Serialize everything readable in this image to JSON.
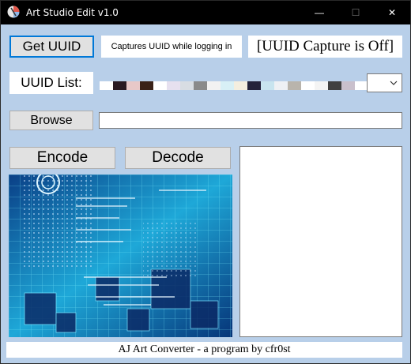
{
  "window": {
    "title": "Art Studio Edit v1.0",
    "controls": {
      "minimize": "—",
      "maximize": "☐",
      "close": "✕"
    }
  },
  "buttons": {
    "get_uuid": "Get UUID",
    "browse": "Browse",
    "encode": "Encode",
    "decode": "Decode"
  },
  "labels": {
    "capture_hint": "Captures UUID while logging in",
    "capture_status": "[UUID Capture is Off]",
    "uuid_list": "UUID List:"
  },
  "uuid_combo": {
    "swatches": [
      "#ffffff",
      "#2a1a22",
      "#e8c8c8",
      "#3a2218",
      "#ffffff",
      "#e6e0ef",
      "#d8dde3",
      "#8a8a8a",
      "#f2f2f2",
      "#d8f0f6",
      "#f4eedf",
      "#24223a",
      "#c8e4ef",
      "#eef0f4",
      "#b9b4ac",
      "#ffffff",
      "#f4f4f4",
      "#404040",
      "#c9c0cc",
      "#ffffff"
    ]
  },
  "browse_path": {
    "value": ""
  },
  "output_box": {
    "value": ""
  },
  "footer": {
    "text": "AJ Art Converter - a program by cfr0st"
  },
  "icons": {
    "app": "app-icon",
    "dropdown": "chevron-down-icon"
  },
  "colors": {
    "window_bg": "#b8cfe9",
    "titlebar_bg": "#000000",
    "button_bg": "#e1e1e1",
    "focus_border": "#0078d7"
  }
}
